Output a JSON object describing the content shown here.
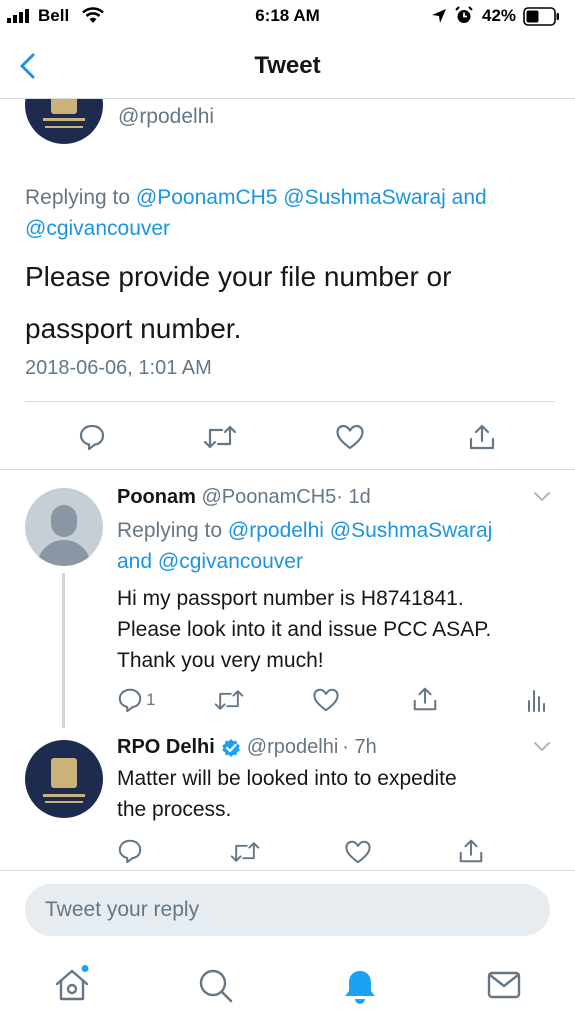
{
  "status_bar": {
    "carrier": "Bell",
    "time": "6:18 AM",
    "battery": "42%",
    "icons": [
      "signal-icon",
      "wifi-icon",
      "location-icon",
      "alarm-icon",
      "battery-icon"
    ]
  },
  "nav": {
    "title": "Tweet",
    "back_icon": "chevron-left-icon"
  },
  "main_tweet": {
    "handle": "@rpodelhi",
    "replying_prefix": "Replying to",
    "replying_to": "@PoonamCH5 @SushmaSwaraj and",
    "replying_to_line2": "@cgivancouver",
    "text_line1": "Please provide your file number or",
    "text_line2": "passport number.",
    "timestamp": "2018-06-06, 1:01 AM"
  },
  "reply_1": {
    "name": "Poonam",
    "handle": "@PoonamCH5",
    "time": "· 1d",
    "replying_prefix": "Replying to",
    "replying_to": "@rpodelhi @SushmaSwaraj",
    "replying_to_line2_prefix": "and",
    "replying_to_line2": "@cgivancouver",
    "text": [
      "Hi my passport number is H8741841.",
      "Please look into it and issue PCC ASAP.",
      "Thank you very much!"
    ],
    "reply_count": "1"
  },
  "reply_2": {
    "name": "RPO Delhi",
    "handle": "@rpodelhi",
    "time": "· 7h",
    "text": [
      "Matter will be looked into to expedite",
      "the process."
    ]
  },
  "composer": {
    "placeholder": "Tweet your reply"
  },
  "tabbar": {
    "items": [
      "home-icon",
      "search-icon",
      "notifications-icon",
      "messages-icon"
    ]
  },
  "colors": {
    "accent": "#1b95e0",
    "text": "#14171a",
    "secondary": "#657786",
    "divider": "#d8dde1",
    "verified": "#1da1f2"
  }
}
